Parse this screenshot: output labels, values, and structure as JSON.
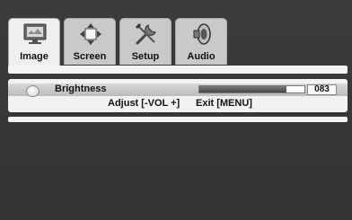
{
  "tabs": [
    {
      "label": "Image",
      "icon": "monitor-icon",
      "active": true
    },
    {
      "label": "Screen",
      "icon": "screen-position-icon",
      "active": false
    },
    {
      "label": "Setup",
      "icon": "tools-icon",
      "active": false
    },
    {
      "label": "Audio",
      "icon": "speaker-icon",
      "active": false
    }
  ],
  "setting": {
    "label": "Brightness",
    "value": "083",
    "level": 0.83
  },
  "hints": {
    "adjust": "Adjust [-VOL +]",
    "exit": "Exit [MENU]"
  },
  "colors": {
    "background": "#3a3a3a",
    "panel": "#f2f2f2",
    "highlight": "#c8c8c8"
  }
}
